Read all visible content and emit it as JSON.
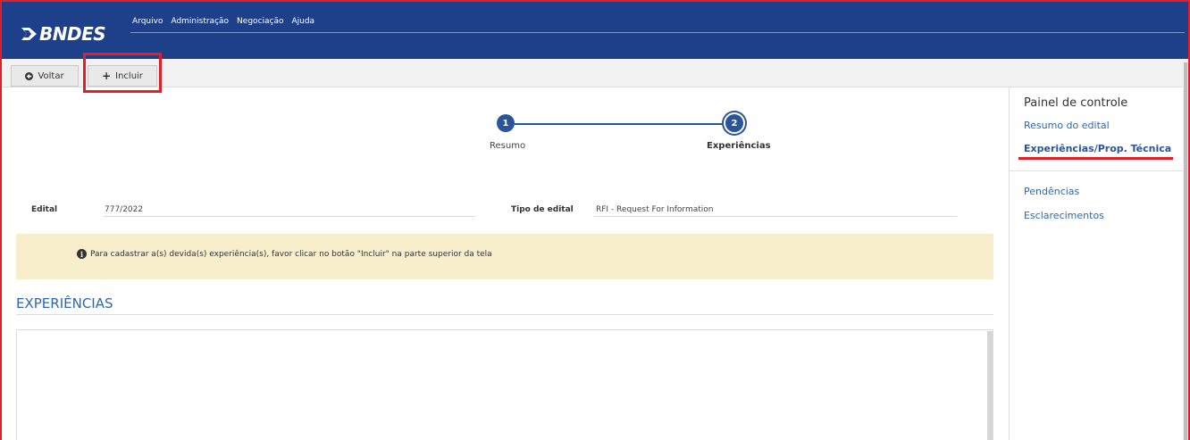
{
  "header": {
    "logo_text": "BNDES",
    "menu": [
      "Arquivo",
      "Administração",
      "Negociação",
      "Ajuda"
    ]
  },
  "toolbar": {
    "back_label": "Voltar",
    "include_label": "Incluir"
  },
  "stepper": {
    "steps": [
      {
        "number": "1",
        "label": "Resumo"
      },
      {
        "number": "2",
        "label": "Experiências"
      }
    ],
    "active_step": 2
  },
  "fields": {
    "edital_label": "Edital",
    "edital_value": "777/2022",
    "tipo_label": "Tipo de edital",
    "tipo_value": "RFI - Request For Information"
  },
  "alert": {
    "icon": "info-icon",
    "text": "Para cadastrar a(s) devida(s) experiência(s), favor clicar no botão \"Incluir\" na parte superior da tela"
  },
  "section": {
    "title": "EXPERIÊNCIAS"
  },
  "panel": {
    "title": "Painel de controle",
    "links": [
      "Resumo do edital",
      "Experiências/Prop. Técnica",
      "Pendências",
      "Esclarecimentos"
    ],
    "active_link": "Experiências/Prop. Técnica"
  },
  "colors": {
    "header_bg": "#1e3f8a",
    "accent": "#2a5599",
    "link": "#2f66b3",
    "alert_bg": "#f9eecb",
    "highlight": "#e41e26"
  }
}
